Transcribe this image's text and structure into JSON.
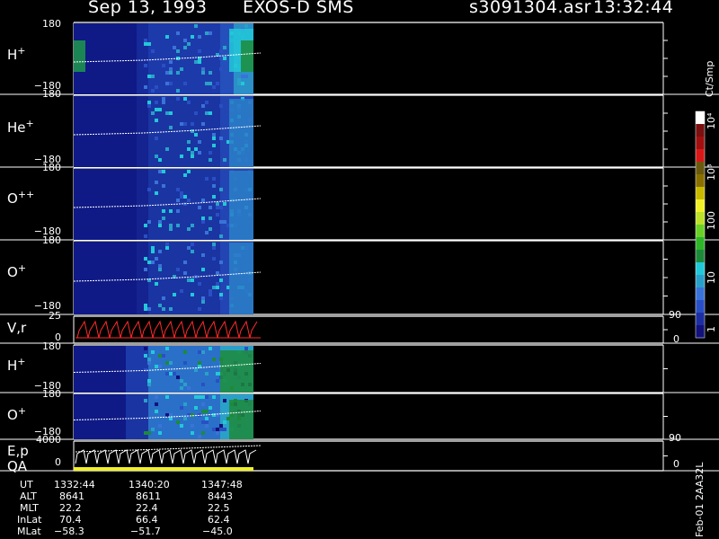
{
  "header": {
    "date": "Sep 13, 1993",
    "instrument": "EXOS-D SMS",
    "file": "s3091304.asr",
    "time": "13:32:44"
  },
  "colorbar": {
    "unit": "Ct/Smp",
    "ticks": [
      "1",
      "10",
      "100",
      "10³",
      "10⁴"
    ],
    "colors": [
      "#12127a",
      "#1d2fa0",
      "#2a4fc4",
      "#3a73d8",
      "#2aa0c8",
      "#22c8d8",
      "#1d8a3a",
      "#2fb42a",
      "#6ad028",
      "#bde02a",
      "#f0f028",
      "#c8b800",
      "#8a7000",
      "#6a5a10",
      "#d81818",
      "#a01010",
      "#7a1010",
      "#ffffff"
    ]
  },
  "panels": [
    {
      "label": "H",
      "sup": "+",
      "ymax": "180",
      "ymin": "−180"
    },
    {
      "label": "He",
      "sup": "+",
      "ymax": "180",
      "ymin": "−180"
    },
    {
      "label": "O",
      "sup": "++",
      "ymax": "180",
      "ymin": "−180"
    },
    {
      "label": "O",
      "sup": "+",
      "ymax": "180",
      "ymin": "−180"
    },
    {
      "label": "V,r",
      "sup": "",
      "ymax": "25",
      "ymin": "0",
      "rmax": "90",
      "rmin": "0"
    },
    {
      "label": "H",
      "sup": "+",
      "ymax": "180",
      "ymin": "−180"
    },
    {
      "label": "O",
      "sup": "+",
      "ymax": "180",
      "ymin": "−180"
    },
    {
      "label": "E,p",
      "sup": "",
      "label2": "QA",
      "ymax": "4000",
      "ymin": "0",
      "rmax": "90",
      "rmin": "0"
    }
  ],
  "footer": {
    "labels": [
      "UT",
      "ALT",
      "MLT",
      "InLat",
      "MLat"
    ],
    "columns": [
      [
        "1332:44",
        "8641",
        "22.2",
        "70.4",
        "−58.3"
      ],
      [
        "1340:20",
        "8611",
        "22.4",
        "66.4",
        "−51.7"
      ],
      [
        "1347:48",
        "8443",
        "22.5",
        "62.4",
        "−45.0"
      ]
    ]
  },
  "side_note": "Feb-01 2AA32L",
  "chart_data": {
    "type": "heatmap",
    "title": "Sep 13, 1993   EXOS-D SMS",
    "x_ticks": [
      "1332:44",
      "1340:20",
      "1347:48"
    ],
    "zlabel": "Ct/Smp",
    "z_scale": "log",
    "zlim": [
      1,
      10000
    ],
    "series": [
      {
        "name": "H+",
        "ylim": [
          -180,
          180
        ]
      },
      {
        "name": "He+",
        "ylim": [
          -180,
          180
        ]
      },
      {
        "name": "O++",
        "ylim": [
          -180,
          180
        ]
      },
      {
        "name": "O+",
        "ylim": [
          -180,
          180
        ]
      },
      {
        "name": "V,r",
        "ylim": [
          0,
          25
        ],
        "y2lim": [
          0,
          90
        ]
      },
      {
        "name": "H+",
        "ylim": [
          -180,
          180
        ]
      },
      {
        "name": "O+",
        "ylim": [
          -180,
          180
        ]
      },
      {
        "name": "E,p",
        "ylim": [
          0,
          4000
        ],
        "y2lim": [
          0,
          90
        ]
      }
    ]
  }
}
